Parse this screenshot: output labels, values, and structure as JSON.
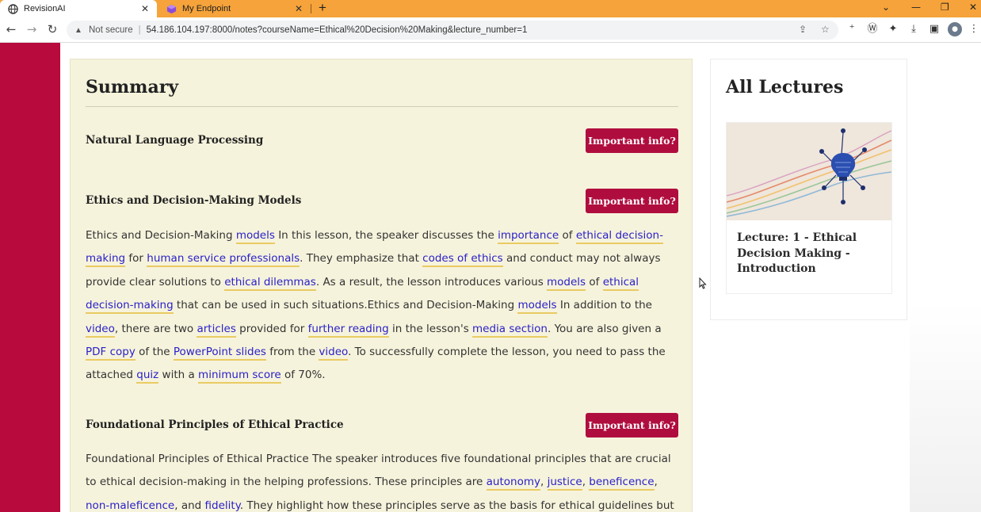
{
  "browser": {
    "tabs": [
      {
        "title": "RevisionAI",
        "close": "✕"
      },
      {
        "title": "My Endpoint",
        "close": "✕"
      }
    ],
    "new_tab": "+",
    "window_controls": {
      "dropdown": "⌄",
      "minimize": "—",
      "restore": "❐",
      "close": "✕"
    },
    "address": {
      "security_label": "Not secure",
      "url": "54.186.104.197:8000/notes?courseName=Ethical%20Decision%20Making&lecture_number=1"
    }
  },
  "summary": {
    "title": "Summary",
    "info_button_label": "Important info?",
    "topics": [
      {
        "heading": "Natural Language Processing"
      },
      {
        "heading": "Ethics and Decision-Making Models"
      },
      {
        "heading": "Foundational Principles of Ethical Practice"
      }
    ],
    "para1": {
      "t0": "Ethics and Decision-Making ",
      "k0": "models",
      "t1": " In this lesson, the speaker discusses the ",
      "k1": "importance",
      "t2": " of ",
      "k2": "ethical decision-making",
      "t3": " for ",
      "k3": "human service professionals",
      "t4": ". They emphasize that ",
      "k4": "codes of ethics",
      "t5": " and conduct may not always provide clear solutions to ",
      "k5": "ethical dilemmas",
      "t6": ". As a result, the lesson introduces various ",
      "k6": "models",
      "t7": " of ",
      "k7": "ethical decision-making",
      "t8": " that can be used in such situations.Ethics and Decision-Making ",
      "k8": "models",
      "t9": " In addition to the ",
      "k9": "video",
      "t10": ", there are two ",
      "k10": "articles",
      "t11": " provided for ",
      "k11": "further reading",
      "t12": " in the lesson's ",
      "k12": "media section",
      "t13": ". You are also given a ",
      "k13": "PDF copy",
      "t14": " of the ",
      "k14": "PowerPoint slides",
      "t15": " from the ",
      "k15": "video",
      "t16": ". To successfully complete the lesson, you need to pass the attached ",
      "k16": "quiz",
      "t17": " with a ",
      "k17": "minimum score",
      "t18": " of 70%."
    },
    "para2": {
      "t0": "Foundational Principles of Ethical Practice The speaker introduces five foundational principles that are crucial to ethical decision-making in the helping professions. These principles are ",
      "k0": "autonomy",
      "t1": ", ",
      "k1": "justice",
      "t2": ", ",
      "k2": "beneficence",
      "t3": ", ",
      "k3": "non-maleficence",
      "t4": ", and ",
      "k4": "fidelity",
      "t5": ". They highlight how these principles serve as the basis for ethical guidelines but"
    }
  },
  "lectures": {
    "title": "All Lectures",
    "items": [
      {
        "name": "Lecture: 1 - Ethical Decision Making - Introduction"
      }
    ]
  },
  "colors": {
    "tab_bar": "#f5a33a",
    "sidebar": "#b80a3d",
    "button": "#b00d3f",
    "summary_bg": "#f6f3dc",
    "keyword": "#2a21c8",
    "keyword_underline": "#e9cb62"
  }
}
